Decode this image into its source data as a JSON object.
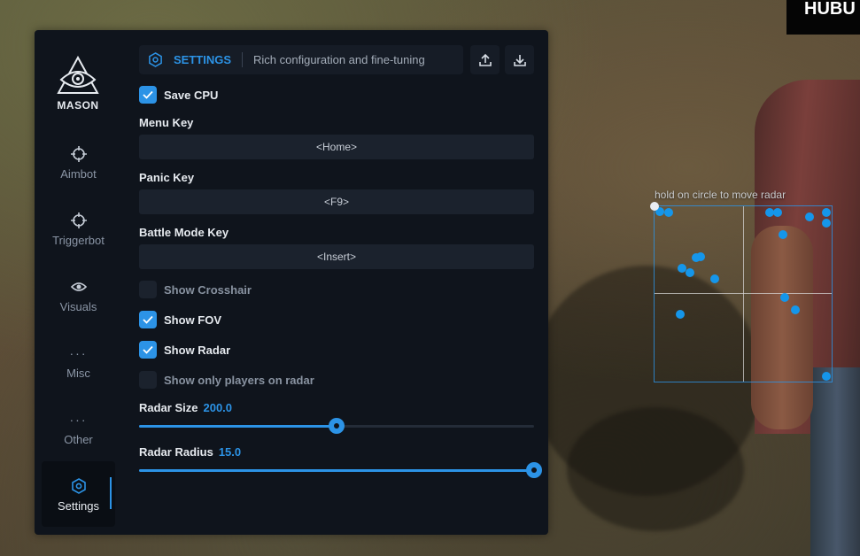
{
  "watermark": "HUBU",
  "brand": {
    "name": "MASON"
  },
  "nav": [
    {
      "label": "Aimbot",
      "icon": "crosshair-icon"
    },
    {
      "label": "Triggerbot",
      "icon": "crosshair-icon"
    },
    {
      "label": "Visuals",
      "icon": "eye-icon"
    },
    {
      "label": "Misc",
      "icon": "dots-icon"
    },
    {
      "label": "Other",
      "icon": "dots-icon"
    },
    {
      "label": "Settings",
      "icon": "gear-icon",
      "active": true
    }
  ],
  "header": {
    "title": "SETTINGS",
    "description": "Rich configuration and fine-tuning",
    "upload_icon": "upload-icon",
    "download_icon": "download-icon"
  },
  "settings": {
    "save_cpu": {
      "label": "Save CPU",
      "checked": true
    },
    "menu_key": {
      "label": "Menu Key",
      "value": "<Home>"
    },
    "panic_key": {
      "label": "Panic Key",
      "value": "<F9>"
    },
    "battle_mode_key": {
      "label": "Battle Mode Key",
      "value": "<Insert>"
    },
    "show_crosshair": {
      "label": "Show Crosshair",
      "checked": false
    },
    "show_fov": {
      "label": "Show FOV",
      "checked": true
    },
    "show_radar": {
      "label": "Show Radar",
      "checked": true
    },
    "show_only_players": {
      "label": "Show only players on radar",
      "checked": false
    },
    "radar_size": {
      "label": "Radar Size",
      "value": "200.0",
      "fraction": 0.5
    },
    "radar_radius": {
      "label": "Radar Radius",
      "value": "15.0",
      "fraction": 1.0
    }
  },
  "radar": {
    "hint": "hold on circle to move radar",
    "blip_count": 20
  },
  "colors": {
    "accent": "#2c93e6",
    "panel": "#0f141c",
    "control": "#1b222d",
    "blip": "#1596ea"
  }
}
